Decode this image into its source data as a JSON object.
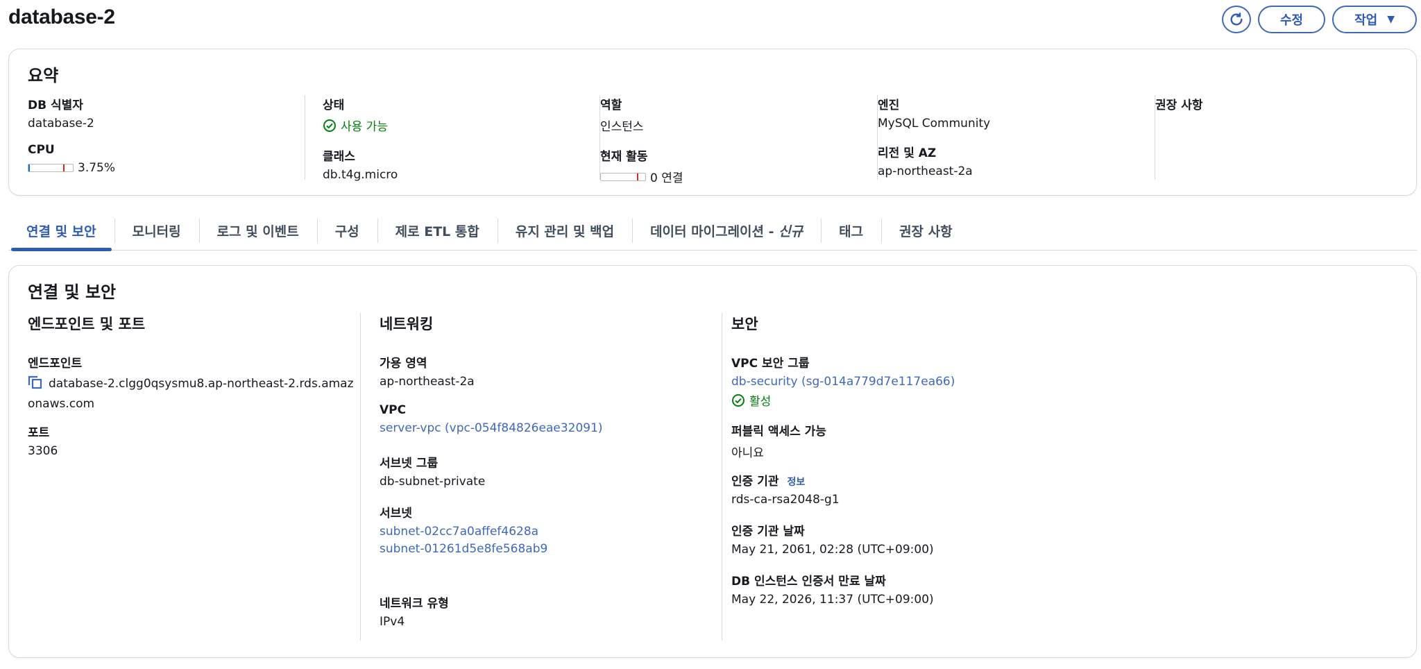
{
  "header": {
    "title": "database-2",
    "refresh_icon": "refresh-icon",
    "modify_label": "수정",
    "actions_label": "작업",
    "actions_caret": "▼"
  },
  "summary": {
    "title": "요약",
    "db_id": {
      "label": "DB 식별자",
      "value": "database-2"
    },
    "cpu": {
      "label": "CPU",
      "value": "3.75%",
      "percent": 3.75
    },
    "status": {
      "label": "상태",
      "value": "사용 가능"
    },
    "class": {
      "label": "클래스",
      "value": "db.t4g.micro"
    },
    "role": {
      "label": "역할",
      "value": "인스턴스"
    },
    "activity": {
      "label": "현재 활동",
      "value": "0 연결",
      "connections": 0
    },
    "engine": {
      "label": "엔진",
      "value": "MySQL Community"
    },
    "region": {
      "label": "리전 및 AZ",
      "value": "ap-northeast-2a"
    },
    "recommendations": {
      "label": "권장 사항"
    }
  },
  "tabs": [
    {
      "label": "연결 및 보안",
      "active": true
    },
    {
      "label": "모니터링"
    },
    {
      "label": "로그 및 이벤트"
    },
    {
      "label": "구성"
    },
    {
      "label": "제로 ETL 통합"
    },
    {
      "label": "유지 관리 및 백업"
    },
    {
      "label": "데이터 마이그레이션 - ",
      "suffix": "신규"
    },
    {
      "label": "태그"
    },
    {
      "label": "권장 사항"
    }
  ],
  "connectivity": {
    "title": "연결 및 보안",
    "endpoint_section": {
      "title": "엔드포인트 및 포트",
      "endpoint_label": "엔드포인트",
      "endpoint_value": "database-2.clgg0qsysmu8.ap-northeast-2.rds.amazonaws.com",
      "port_label": "포트",
      "port_value": "3306"
    },
    "network_section": {
      "title": "네트워킹",
      "az_label": "가용 영역",
      "az_value": "ap-northeast-2a",
      "vpc_label": "VPC",
      "vpc_value": "server-vpc (vpc-054f84826eae32091)",
      "subnet_group_label": "서브넷 그룹",
      "subnet_group_value": "db-subnet-private",
      "subnets_label": "서브넷",
      "subnets": [
        "subnet-02cc7a0affef4628a",
        "subnet-01261d5e8fe568ab9"
      ],
      "network_type_label": "네트워크 유형",
      "network_type_value": "IPv4"
    },
    "security_section": {
      "title": "보안",
      "sg_label": "VPC 보안 그룹",
      "sg_value": "db-security (sg-014a779d7e117ea66)",
      "sg_status": "활성",
      "public_label": "퍼블릭 액세스 가능",
      "public_value": "아니요",
      "ca_label": "인증 기관",
      "ca_info": "정보",
      "ca_value": "rds-ca-rsa2048-g1",
      "ca_date_label": "인증 기관 날짜",
      "ca_date_value": "May 21, 2061, 02:28 (UTC+09:00)",
      "cert_expiry_label": "DB 인스턴스 인증서 만료 날짜",
      "cert_expiry_value": "May 22, 2026, 11:37 (UTC+09:00)"
    }
  },
  "colors": {
    "link": "#3f68b8",
    "success": "#037f0c",
    "border": "#d5dbdb",
    "active_tab": "#2f5bb3"
  }
}
